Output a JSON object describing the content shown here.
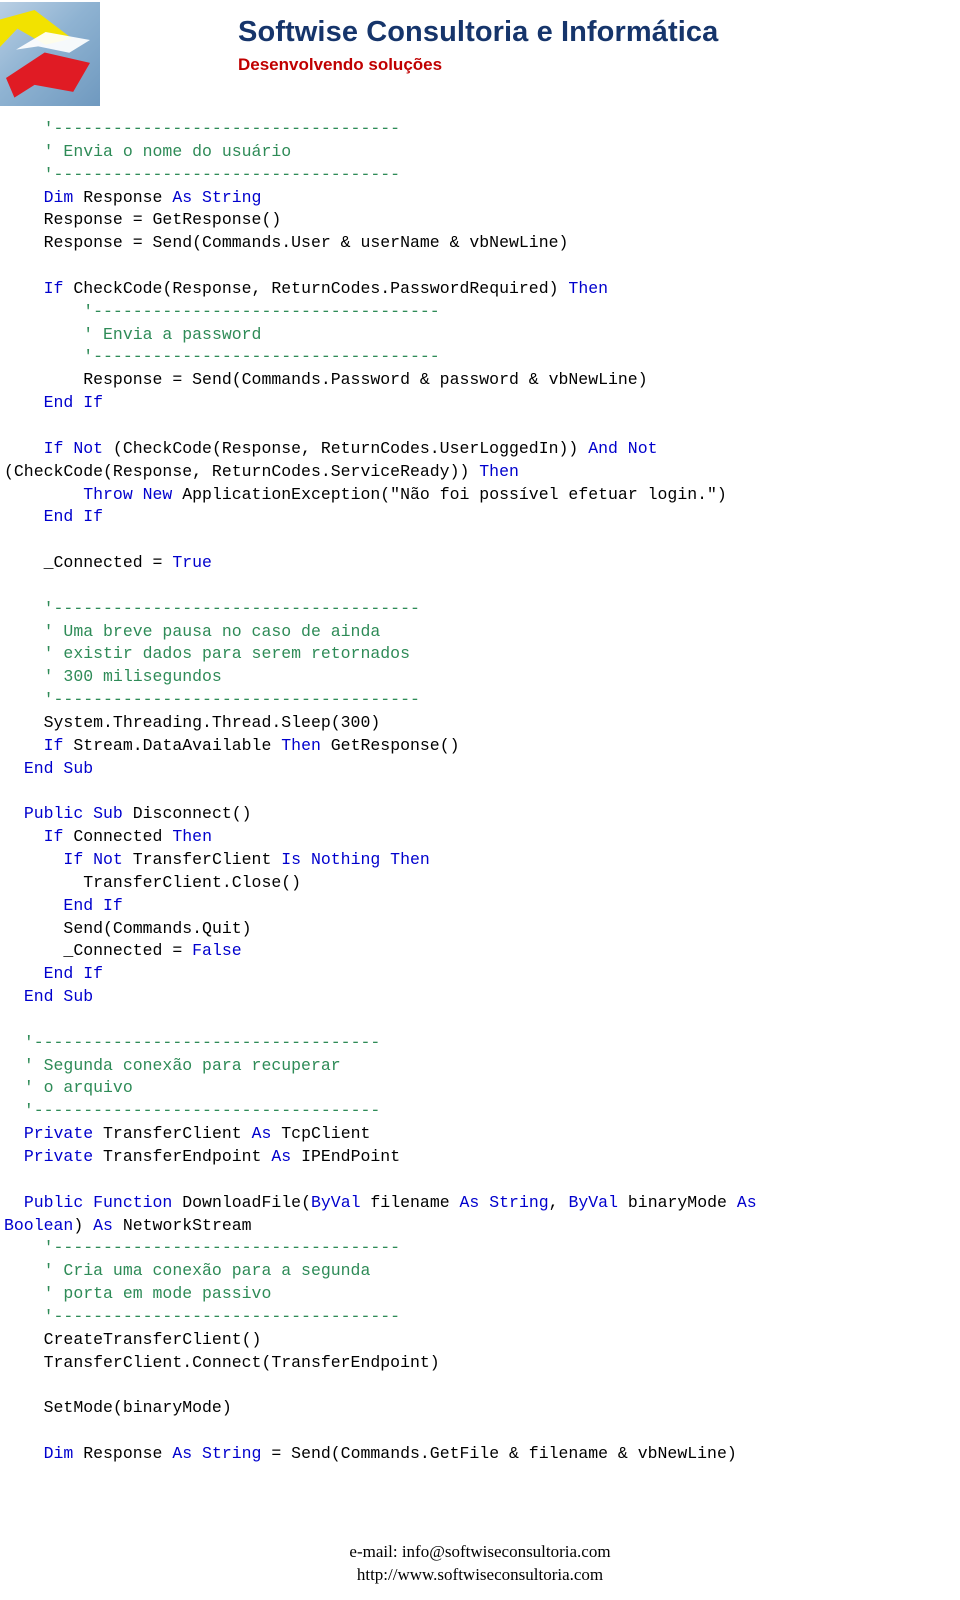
{
  "header": {
    "company": "Softwise Consultoria e Informática",
    "tagline": "Desenvolvendo soluções",
    "logo_name": "softwise-logo"
  },
  "code": {
    "lines": [
      [
        {
          "t": "cm",
          "s": "    '-----------------------------------"
        }
      ],
      [
        {
          "t": "cm",
          "s": "    ' Envia o nome do usuário"
        }
      ],
      [
        {
          "t": "cm",
          "s": "    '-----------------------------------"
        }
      ],
      [
        {
          "t": "kw",
          "s": "    Dim "
        },
        {
          "t": "pl",
          "s": "Response "
        },
        {
          "t": "kw",
          "s": "As String"
        }
      ],
      [
        {
          "t": "pl",
          "s": "    Response = GetResponse()"
        }
      ],
      [
        {
          "t": "pl",
          "s": "    Response = Send(Commands.User & userName & vbNewLine)"
        }
      ],
      [
        {
          "t": "pl",
          "s": ""
        }
      ],
      [
        {
          "t": "kw",
          "s": "    If "
        },
        {
          "t": "pl",
          "s": "CheckCode(Response, ReturnCodes.PasswordRequired) "
        },
        {
          "t": "kw",
          "s": "Then"
        }
      ],
      [
        {
          "t": "cm",
          "s": "        '-----------------------------------"
        }
      ],
      [
        {
          "t": "cm",
          "s": "        ' Envia a password"
        }
      ],
      [
        {
          "t": "cm",
          "s": "        '-----------------------------------"
        }
      ],
      [
        {
          "t": "pl",
          "s": "        Response = Send(Commands.Password & password & vbNewLine)"
        }
      ],
      [
        {
          "t": "kw",
          "s": "    End If"
        }
      ],
      [
        {
          "t": "pl",
          "s": ""
        }
      ],
      [
        {
          "t": "kw",
          "s": "    If Not "
        },
        {
          "t": "pl",
          "s": "(CheckCode(Response, ReturnCodes.UserLoggedIn)) "
        },
        {
          "t": "kw",
          "s": "And Not"
        }
      ],
      [
        {
          "t": "pl",
          "s": "(CheckCode(Response, ReturnCodes.ServiceReady)) "
        },
        {
          "t": "kw",
          "s": "Then"
        }
      ],
      [
        {
          "t": "kw",
          "s": "        Throw New "
        },
        {
          "t": "pl",
          "s": "ApplicationException(\"Não foi possível efetuar login.\")"
        }
      ],
      [
        {
          "t": "kw",
          "s": "    End If"
        }
      ],
      [
        {
          "t": "pl",
          "s": ""
        }
      ],
      [
        {
          "t": "pl",
          "s": "    _Connected = "
        },
        {
          "t": "kw",
          "s": "True"
        }
      ],
      [
        {
          "t": "pl",
          "s": ""
        }
      ],
      [
        {
          "t": "cm",
          "s": "    '-------------------------------------"
        }
      ],
      [
        {
          "t": "cm",
          "s": "    ' Uma breve pausa no caso de ainda"
        }
      ],
      [
        {
          "t": "cm",
          "s": "    ' existir dados para serem retornados"
        }
      ],
      [
        {
          "t": "cm",
          "s": "    ' 300 milisegundos"
        }
      ],
      [
        {
          "t": "cm",
          "s": "    '-------------------------------------"
        }
      ],
      [
        {
          "t": "pl",
          "s": "    System.Threading.Thread.Sleep(300)"
        }
      ],
      [
        {
          "t": "kw",
          "s": "    If "
        },
        {
          "t": "pl",
          "s": "Stream.DataAvailable "
        },
        {
          "t": "kw",
          "s": "Then "
        },
        {
          "t": "pl",
          "s": "GetResponse()"
        }
      ],
      [
        {
          "t": "kw",
          "s": "  End Sub"
        }
      ],
      [
        {
          "t": "pl",
          "s": ""
        }
      ],
      [
        {
          "t": "kw",
          "s": "  Public Sub "
        },
        {
          "t": "pl",
          "s": "Disconnect()"
        }
      ],
      [
        {
          "t": "kw",
          "s": "    If "
        },
        {
          "t": "pl",
          "s": "Connected "
        },
        {
          "t": "kw",
          "s": "Then"
        }
      ],
      [
        {
          "t": "kw",
          "s": "      If Not "
        },
        {
          "t": "pl",
          "s": "TransferClient "
        },
        {
          "t": "kw",
          "s": "Is Nothing Then"
        }
      ],
      [
        {
          "t": "pl",
          "s": "        TransferClient.Close()"
        }
      ],
      [
        {
          "t": "kw",
          "s": "      End If"
        }
      ],
      [
        {
          "t": "pl",
          "s": "      Send(Commands.Quit)"
        }
      ],
      [
        {
          "t": "pl",
          "s": "      _Connected = "
        },
        {
          "t": "kw",
          "s": "False"
        }
      ],
      [
        {
          "t": "kw",
          "s": "    End If"
        }
      ],
      [
        {
          "t": "kw",
          "s": "  End Sub"
        }
      ],
      [
        {
          "t": "pl",
          "s": ""
        }
      ],
      [
        {
          "t": "cm",
          "s": "  '-----------------------------------"
        }
      ],
      [
        {
          "t": "cm",
          "s": "  ' Segunda conexão para recuperar"
        }
      ],
      [
        {
          "t": "cm",
          "s": "  ' o arquivo"
        }
      ],
      [
        {
          "t": "cm",
          "s": "  '-----------------------------------"
        }
      ],
      [
        {
          "t": "kw",
          "s": "  Private "
        },
        {
          "t": "pl",
          "s": "TransferClient "
        },
        {
          "t": "kw",
          "s": "As "
        },
        {
          "t": "pl",
          "s": "TcpClient"
        }
      ],
      [
        {
          "t": "kw",
          "s": "  Private "
        },
        {
          "t": "pl",
          "s": "TransferEndpoint "
        },
        {
          "t": "kw",
          "s": "As "
        },
        {
          "t": "pl",
          "s": "IPEndPoint"
        }
      ],
      [
        {
          "t": "pl",
          "s": ""
        }
      ],
      [
        {
          "t": "kw",
          "s": "  Public Function "
        },
        {
          "t": "pl",
          "s": "DownloadFile("
        },
        {
          "t": "kw",
          "s": "ByVal "
        },
        {
          "t": "pl",
          "s": "filename "
        },
        {
          "t": "kw",
          "s": "As String"
        },
        {
          "t": "pl",
          "s": ", "
        },
        {
          "t": "kw",
          "s": "ByVal "
        },
        {
          "t": "pl",
          "s": "binaryMode "
        },
        {
          "t": "kw",
          "s": "As"
        }
      ],
      [
        {
          "t": "kw",
          "s": "Boolean"
        },
        {
          "t": "pl",
          "s": ") "
        },
        {
          "t": "kw",
          "s": "As "
        },
        {
          "t": "pl",
          "s": "NetworkStream"
        }
      ],
      [
        {
          "t": "cm",
          "s": "    '-----------------------------------"
        }
      ],
      [
        {
          "t": "cm",
          "s": "    ' Cria uma conexão para a segunda"
        }
      ],
      [
        {
          "t": "cm",
          "s": "    ' porta em mode passivo"
        }
      ],
      [
        {
          "t": "cm",
          "s": "    '-----------------------------------"
        }
      ],
      [
        {
          "t": "pl",
          "s": "    CreateTransferClient()"
        }
      ],
      [
        {
          "t": "pl",
          "s": "    TransferClient.Connect(TransferEndpoint)"
        }
      ],
      [
        {
          "t": "pl",
          "s": ""
        }
      ],
      [
        {
          "t": "pl",
          "s": "    SetMode(binaryMode)"
        }
      ],
      [
        {
          "t": "pl",
          "s": ""
        }
      ],
      [
        {
          "t": "kw",
          "s": "    Dim "
        },
        {
          "t": "pl",
          "s": "Response "
        },
        {
          "t": "kw",
          "s": "As String"
        },
        {
          "t": "pl",
          "s": " = Send(Commands.GetFile & filename & vbNewLine)"
        }
      ]
    ]
  },
  "footer": {
    "email": "e-mail: info@softwiseconsultoria.com",
    "site": "http://www.softwiseconsultoria.com"
  },
  "colors": {
    "keyword": "#0000cd",
    "comment": "#2e8b57",
    "company_title": "#16356b",
    "tagline": "#c00000"
  }
}
